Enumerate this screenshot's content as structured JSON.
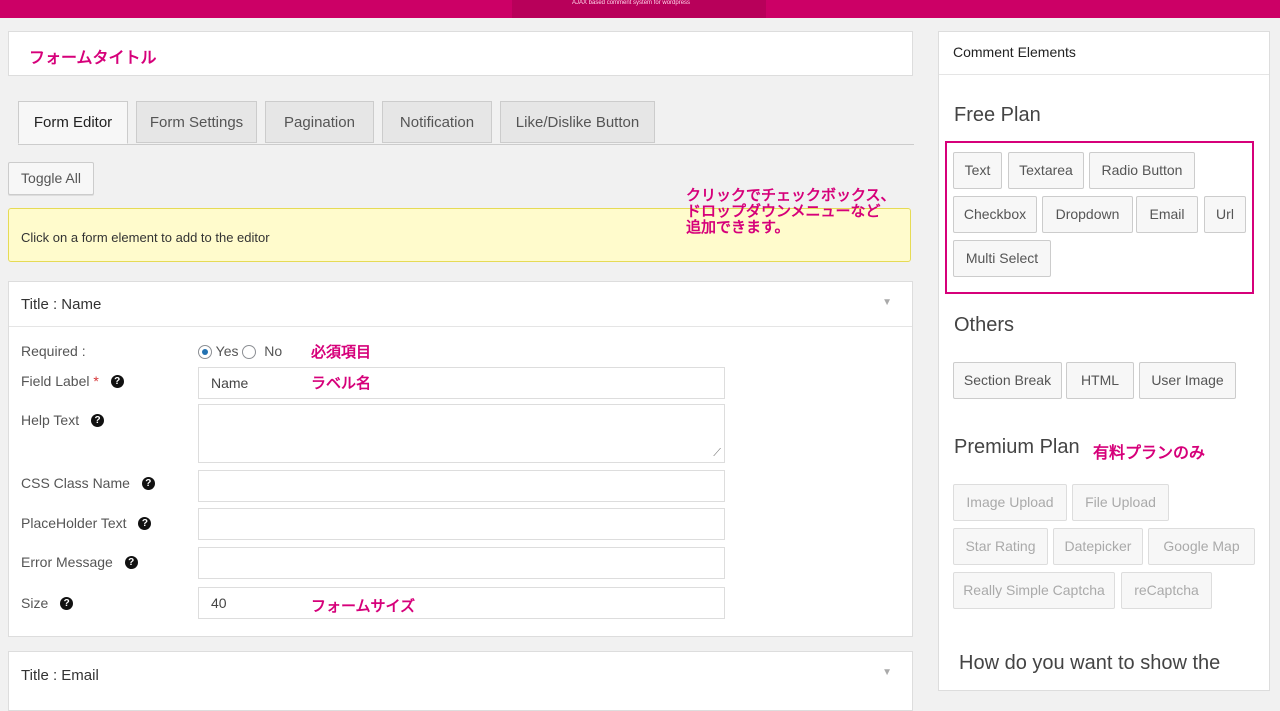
{
  "header": {
    "brand_color": "#cc0066",
    "subtitle": "AJAX based comment system for wordpress"
  },
  "form_title": "フォームタイトル",
  "tabs": [
    {
      "label": "Form Editor",
      "active": true
    },
    {
      "label": "Form Settings",
      "active": false
    },
    {
      "label": "Pagination",
      "active": false
    },
    {
      "label": "Notification",
      "active": false
    },
    {
      "label": "Like/Dislike Button",
      "active": false
    }
  ],
  "toggle_all_label": "Toggle All",
  "notice_text": "Click on a form element to add to the editor",
  "annotations": {
    "click_note_1": "クリックでチェックボックス、",
    "click_note_2": "ドロップダウンメニューなど",
    "click_note_3": "追加できます。",
    "required": "必須項目",
    "label_name": "ラベル名",
    "form_size": "フォームサイズ",
    "premium_only": "有料プランのみ"
  },
  "field_panel": {
    "title": "Title : Name",
    "arrow": "▼",
    "required_label": "Required :",
    "yes_label": "Yes",
    "no_label": "No",
    "required_value": "yes",
    "field_label_label": "Field Label",
    "field_label_star": "*",
    "field_label_value": "Name",
    "help_text_label": "Help Text",
    "help_text_value": "",
    "css_class_label": "CSS Class Name",
    "css_class_value": "",
    "placeholder_label": "PlaceHolder Text",
    "placeholder_value": "",
    "error_message_label": "Error Message",
    "error_message_value": "",
    "size_label": "Size",
    "size_value": "40",
    "help_icon": "?"
  },
  "next_panel": {
    "title": "Title : Email",
    "arrow": "▼"
  },
  "sidebar": {
    "heading": "Comment Elements",
    "free_plan_title": "Free Plan",
    "free_items": [
      "Text",
      "Textarea",
      "Radio Button",
      "Checkbox",
      "Dropdown",
      "Email",
      "Url",
      "Multi Select"
    ],
    "others_title": "Others",
    "other_items": [
      "Section Break",
      "HTML",
      "User Image"
    ],
    "premium_title": "Premium Plan",
    "premium_items": [
      "Image Upload",
      "File Upload",
      "Star Rating",
      "Datepicker",
      "Google Map",
      "Really Simple Captcha",
      "reCaptcha"
    ],
    "footer_question": "How do you want to show the"
  }
}
